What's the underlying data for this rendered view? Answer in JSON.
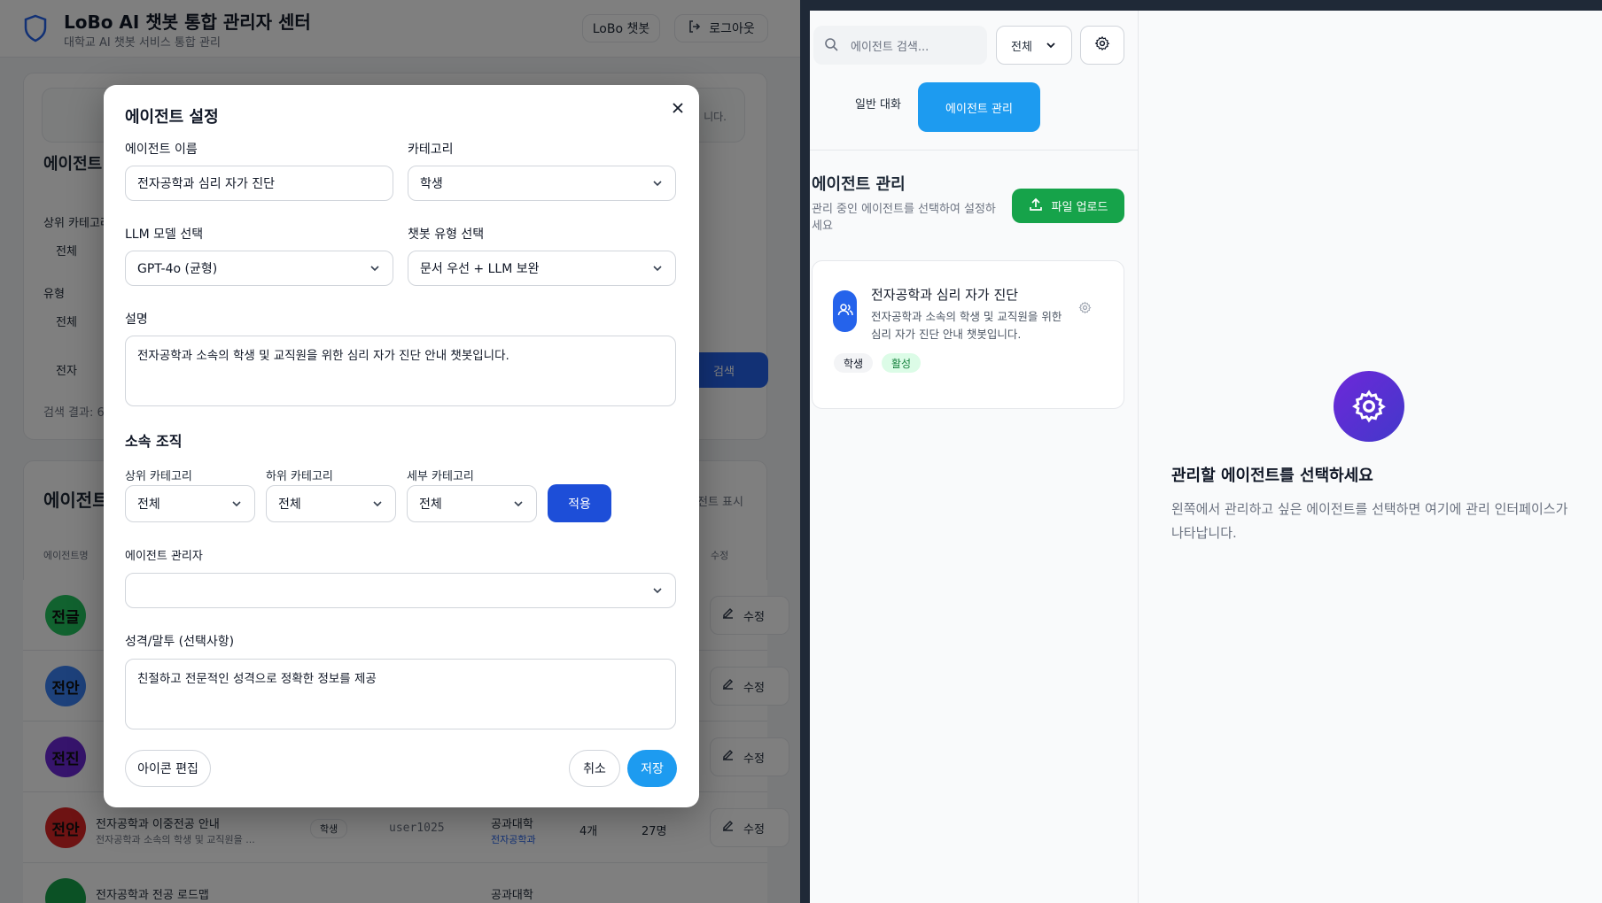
{
  "admin": {
    "title": "LoBo AI 챗봇 통합 관리자 센터",
    "subtitle": "대학교 AI 챗봇 서비스 통합 관리",
    "chatbot_button": "LoBo 챗봇",
    "logout_button": "로그아웃",
    "search_section_title": "에이전트",
    "filter_parent_label": "상위 카테고리",
    "filter_parent_value": "전체",
    "filter_type_label": "유형",
    "filter_type_value": "전체",
    "search_value": "전자",
    "search_button": "검색",
    "result_text": "검색 결과: 6",
    "notice_tail": "니다.",
    "list_title": "에이전트",
    "show_toggle": "전트 표시",
    "col_name": "에이전트명",
    "col_edit": "수정",
    "edit_label": "수정",
    "rows": [
      {
        "avatar": "전글",
        "color": "#22c55e",
        "name": "전",
        "desc": "전"
      },
      {
        "avatar": "전안",
        "color": "#3b82f6",
        "name": "전",
        "desc": "전"
      },
      {
        "avatar": "전진",
        "color": "#6d28d9",
        "name": "전",
        "desc": "전"
      },
      {
        "avatar": "전안",
        "color": "#dc2626",
        "name": "전자공학과 이중전공 안내",
        "desc": "전자공학과 소속의 학생 및 교직원을 ...",
        "category": "학생",
        "owner": "user1025",
        "college": "공과대학",
        "dept": "전자공학과",
        "docs": "4개",
        "users": "27명"
      },
      {
        "avatar": "",
        "color": "#16a34a",
        "name": "전자공학과 전공 로드맵",
        "college": "공과대학"
      }
    ]
  },
  "modal": {
    "title": "에이전트 설정",
    "name_label": "에이전트 이름",
    "name_value": "전자공학과 심리 자가 진단",
    "category_label": "카테고리",
    "category_value": "학생",
    "llm_label": "LLM 모델 선택",
    "llm_value": "GPT-4o (균형)",
    "type_label": "챗봇 유형 선택",
    "type_value": "문서 우선 + LLM 보완",
    "desc_label": "설명",
    "desc_value": "전자공학과 소속의 학생 및 교직원을 위한 심리 자가 진단 안내 챗봇입니다.",
    "org_title": "소속 조직",
    "org_parent_label": "상위 카테고리",
    "org_parent_value": "전체",
    "org_child_label": "하위 카테고리",
    "org_child_value": "전체",
    "org_detail_label": "세부 카테고리",
    "org_detail_value": "전체",
    "apply_button": "적용",
    "manager_label": "에이전트 관리자",
    "manager_value": "",
    "persona_label": "성격/말투 (선택사항)",
    "persona_value": "친절하고 전문적인 성격으로 정확한 정보를 제공",
    "icon_edit_button": "아이콘 편집",
    "cancel_button": "취소",
    "save_button": "저장"
  },
  "chat": {
    "search_placeholder": "에이전트 검색...",
    "filter_value": "전체",
    "tab_general": "일반 대화",
    "tab_agent": "에이전트 관리",
    "section_title": "에이전트 관리",
    "section_desc": "관리 중인 에이전트를 선택하여 설정하세요",
    "upload_button": "파일 업로드",
    "agent_name": "전자공학과 심리 자가 진단",
    "agent_desc": "전자공학과 소속의 학생 및 교직원을 위한 심리 자가 진단 안내 챗봇입니다.",
    "tag_category": "학생",
    "tag_status": "활성",
    "empty_title": "관리할 에이전트를 선택하세요",
    "empty_desc": "왼쪽에서 관리하고 싶은 에이전트를 선택하면 여기에 관리 인터페이스가 나타납니다."
  },
  "colors": {
    "primary": "#2563eb",
    "sky": "#1d9bf0",
    "green": "#16a34a",
    "purple": "#6d28d9"
  }
}
